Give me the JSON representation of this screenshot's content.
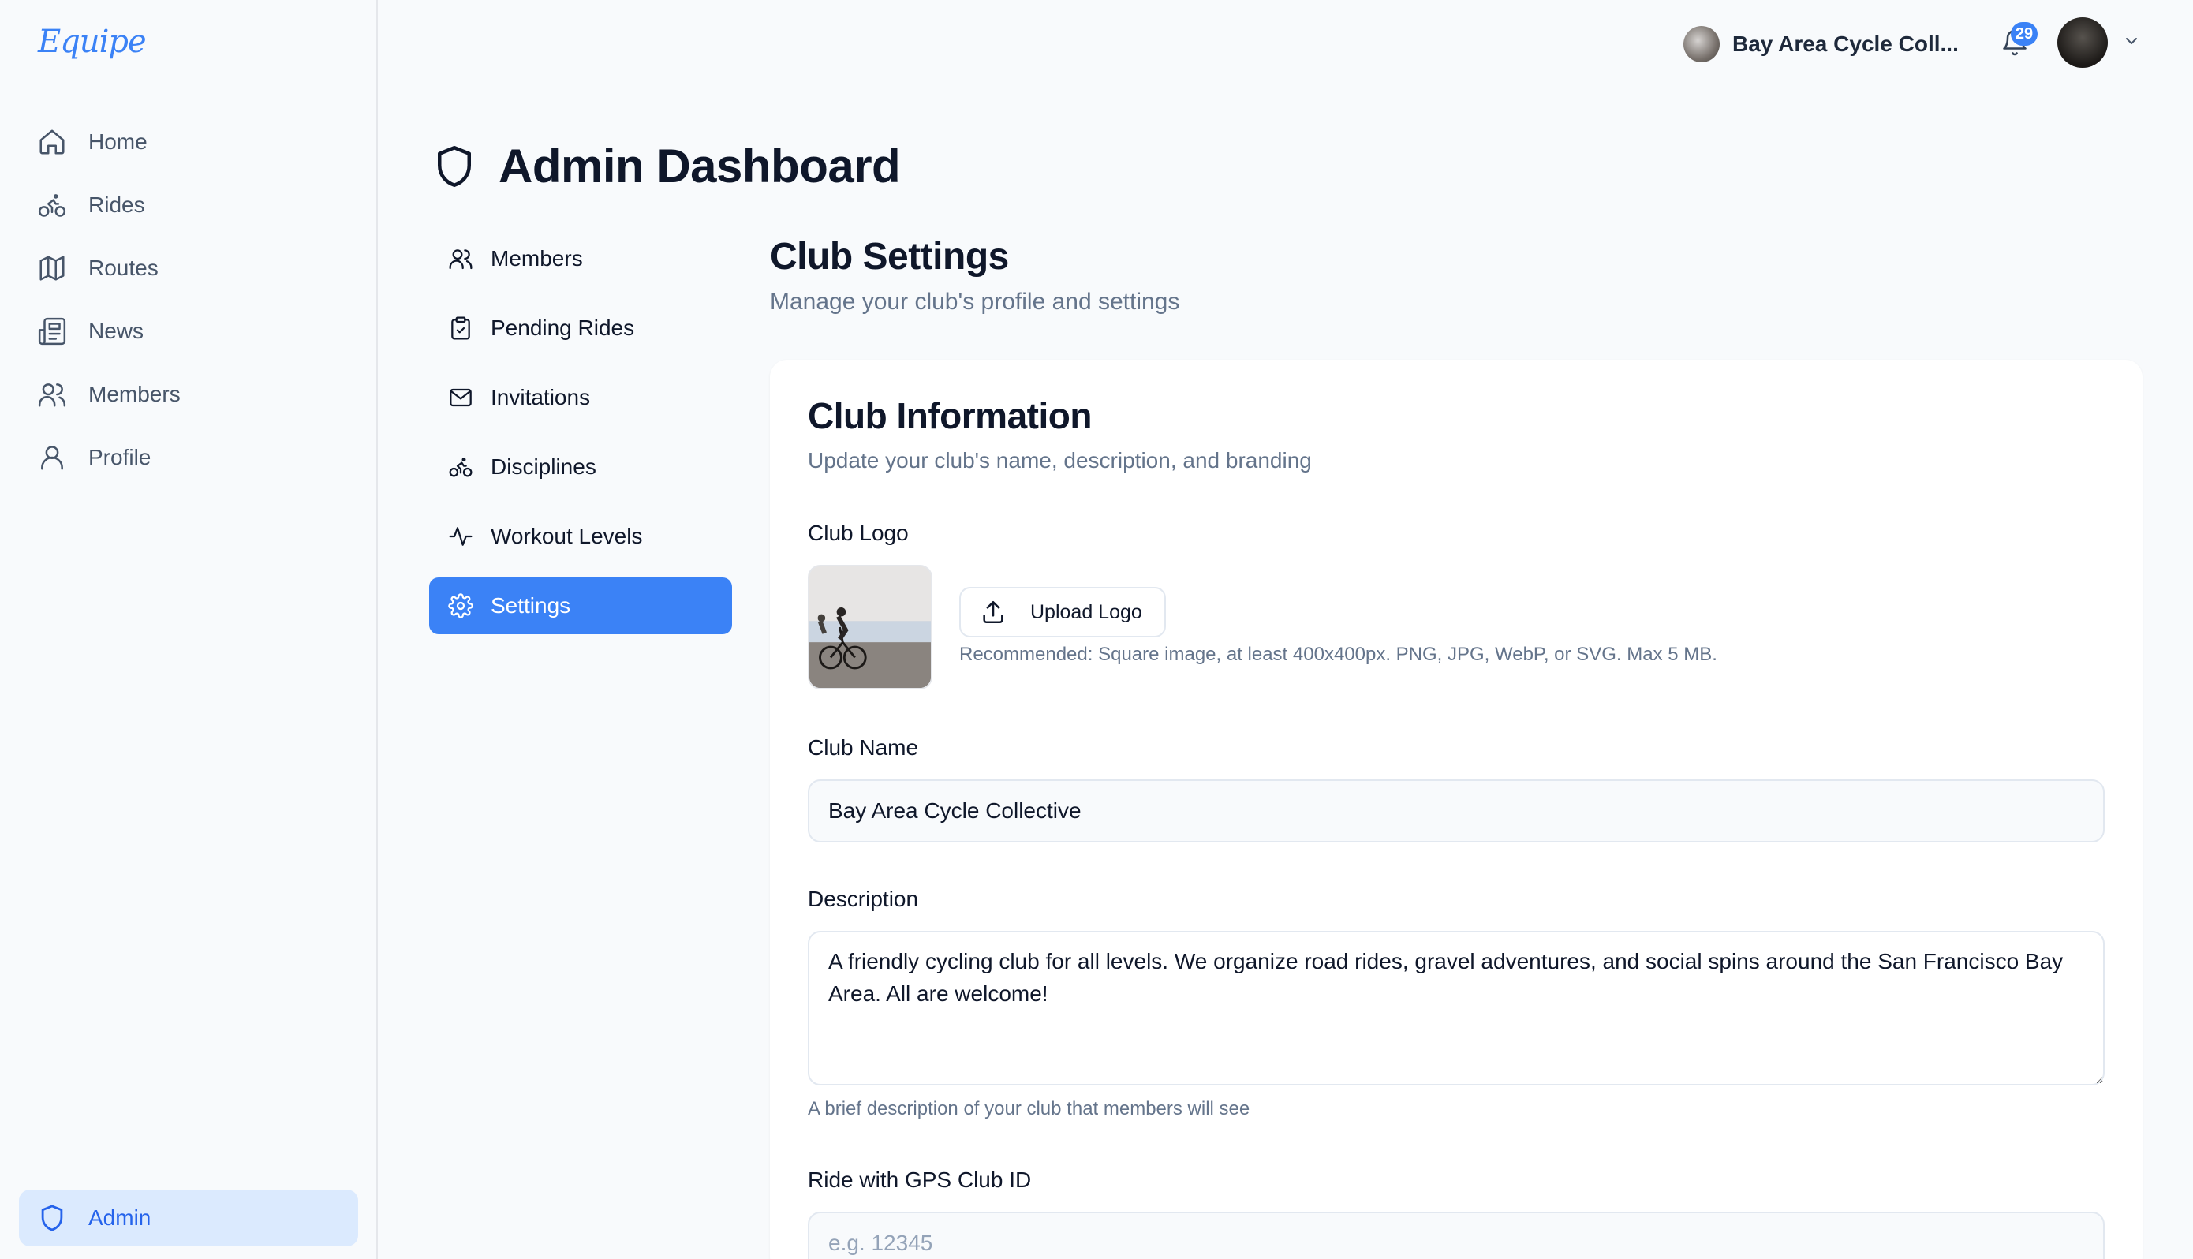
{
  "app": {
    "logo_text": "Equipe"
  },
  "sidebar": {
    "items": [
      {
        "label": "Home",
        "icon": "home-icon"
      },
      {
        "label": "Rides",
        "icon": "bike-icon"
      },
      {
        "label": "Routes",
        "icon": "map-icon"
      },
      {
        "label": "News",
        "icon": "newspaper-icon"
      },
      {
        "label": "Members",
        "icon": "users-icon"
      },
      {
        "label": "Profile",
        "icon": "user-icon"
      }
    ],
    "admin_label": "Admin"
  },
  "topbar": {
    "club_name": "Bay Area Cycle Coll...",
    "notification_count": "29"
  },
  "page": {
    "title": "Admin Dashboard"
  },
  "admin_nav": {
    "items": [
      {
        "label": "Members",
        "icon": "users-icon"
      },
      {
        "label": "Pending Rides",
        "icon": "clipboard-check-icon"
      },
      {
        "label": "Invitations",
        "icon": "mail-icon"
      },
      {
        "label": "Disciplines",
        "icon": "bike-icon"
      },
      {
        "label": "Workout Levels",
        "icon": "activity-icon"
      },
      {
        "label": "Settings",
        "icon": "gear-icon",
        "active": true
      }
    ]
  },
  "settings": {
    "title": "Club Settings",
    "subtitle": "Manage your club's profile and settings",
    "card": {
      "title": "Club Information",
      "subtitle": "Update your club's name, description, and branding",
      "logo_label": "Club Logo",
      "upload_label": "Upload Logo",
      "upload_hint": "Recommended: Square image, at least 400x400px. PNG, JPG, WebP, or SVG. Max 5 MB.",
      "name_label": "Club Name",
      "name_value": "Bay Area Cycle Collective",
      "description_label": "Description",
      "description_value": "A friendly cycling club for all levels. We organize road rides, gravel adventures, and social spins around the San Francisco Bay Area. All are welcome!",
      "description_hint": "A brief description of your club that members will see",
      "gps_label": "Ride with GPS Club ID",
      "gps_placeholder": "e.g. 12345",
      "gps_value": ""
    }
  },
  "colors": {
    "accent": "#3b82f6",
    "admin_bg": "#dbeafe",
    "text_muted": "#64748b",
    "page_bg": "#f8fafc"
  }
}
